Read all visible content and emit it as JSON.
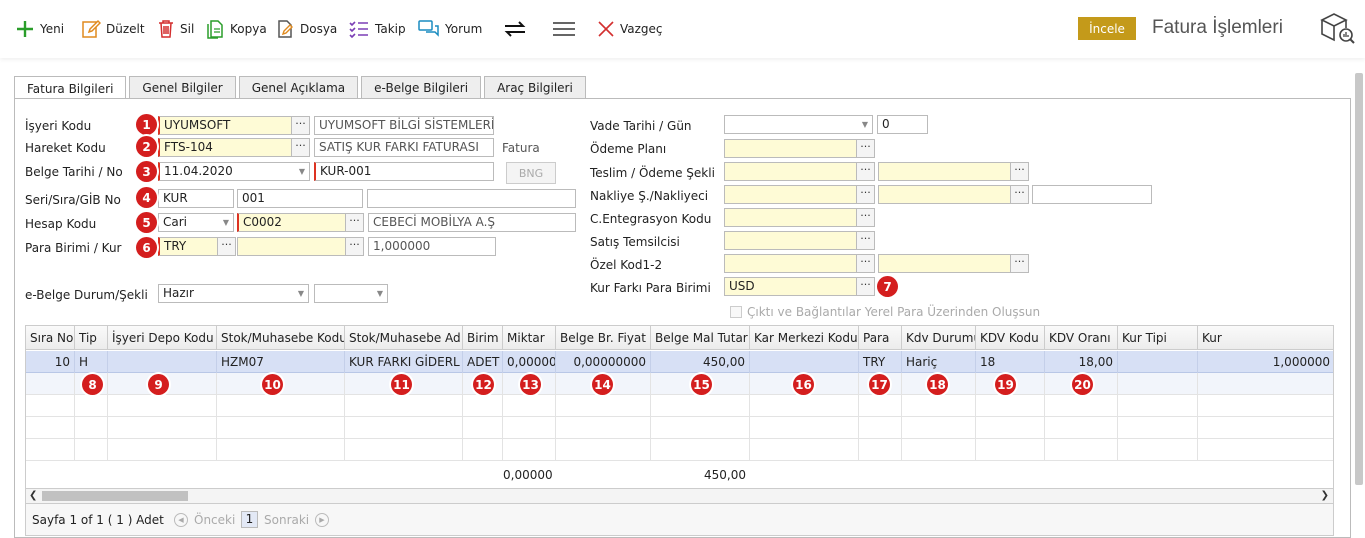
{
  "toolbar": {
    "new": "Yeni",
    "edit": "Düzelt",
    "delete": "Sil",
    "copy": "Kopya",
    "file": "Dosya",
    "follow": "Takip",
    "comment": "Yorum",
    "cancel": "Vazgeç",
    "inspect": "İncele",
    "title": "Fatura İşlemleri",
    "colors": {
      "green": "#2a9d2a",
      "orange": "#e08a1e",
      "red": "#d32f2f",
      "purple": "#7b3fb5",
      "teal": "#1a8cc0",
      "gold": "#c49a1a"
    }
  },
  "tabs": [
    "Fatura Bilgileri",
    "Genel Bilgiler",
    "Genel Açıklama",
    "e-Belge Bilgileri",
    "Araç Bilgileri"
  ],
  "left": {
    "workplace_label": "İşyeri Kodu",
    "workplace_code": "UYUMSOFT",
    "workplace_name": "UYUMSOFT BİLGİ SİSTEMLERİ",
    "movement_label": "Hareket Kodu",
    "movement_code": "FTS-104",
    "movement_name": "SATIŞ KUR FARKI FATURASI",
    "movement_type": "Fatura",
    "doc_label": "Belge Tarihi / No",
    "doc_date": "11.04.2020",
    "doc_no": "KUR-001",
    "bng": "BNG",
    "serial_label": "Seri/Sıra/GİB No",
    "serial": "KUR",
    "sequence": "001",
    "gib_no": "",
    "account_label": "Hesap Kodu",
    "account_type": "Cari",
    "account_code": "C0002",
    "account_name": "CEBECİ MOBİLYA A.Ş",
    "currency_label": "Para Birimi / Kur",
    "currency": "TRY",
    "currency_extra": "",
    "rate": "1,000000",
    "ebelge_label": "e-Belge Durum/Şekli",
    "ebelge_status": "Hazır",
    "ebelge_form": ""
  },
  "right": {
    "due_label": "Vade Tarihi / Gün",
    "due_date": "",
    "due_days": "0",
    "payment_plan_label": "Ödeme Planı",
    "delivery_label": "Teslim / Ödeme Şekli",
    "shipping_label": "Nakliye Ş./Nakliyeci",
    "integration_label": "C.Entegrasyon Kodu",
    "sales_rep_label": "Satış Temsilcisi",
    "special_label": "Özel Kod1-2",
    "fx_label": "Kur Farkı Para Birimi",
    "fx_currency": "USD",
    "local_output_label": "Çıktı ve Bağlantılar Yerel Para Üzerinden Oluşsun"
  },
  "badges": [
    "1",
    "2",
    "3",
    "4",
    "5",
    "6",
    "7",
    "8",
    "9",
    "10",
    "11",
    "12",
    "13",
    "14",
    "15",
    "16",
    "17",
    "18",
    "19",
    "20"
  ],
  "grid": {
    "columns": [
      "Sıra No",
      "Tip",
      "İşyeri Depo Kodu",
      "Stok/Muhasebe Kodu",
      "Stok/Muhasebe Ad",
      "Birim",
      "Miktar",
      "Belge Br. Fiyat",
      "Belge Mal Tutar",
      "Kar Merkezi Kodu",
      "Para",
      "Kdv Durumu",
      "KDV Kodu",
      "KDV Oranı",
      "Kur Tipi",
      "Kur"
    ],
    "row": [
      "10",
      "H",
      "",
      "HZM07",
      "KUR FARKI GİDERL",
      "ADET",
      "0,00000",
      "0,00000000",
      "450,00",
      "",
      "TRY",
      "Hariç",
      "18",
      "18,00",
      "",
      "1,000000"
    ],
    "totals": {
      "quantity": "0,00000",
      "amount": "450,00"
    }
  },
  "pager": {
    "info": "Sayfa 1 of 1 ( 1 ) Adet",
    "prev": "Önceki",
    "page": "1",
    "next": "Sonraki"
  }
}
